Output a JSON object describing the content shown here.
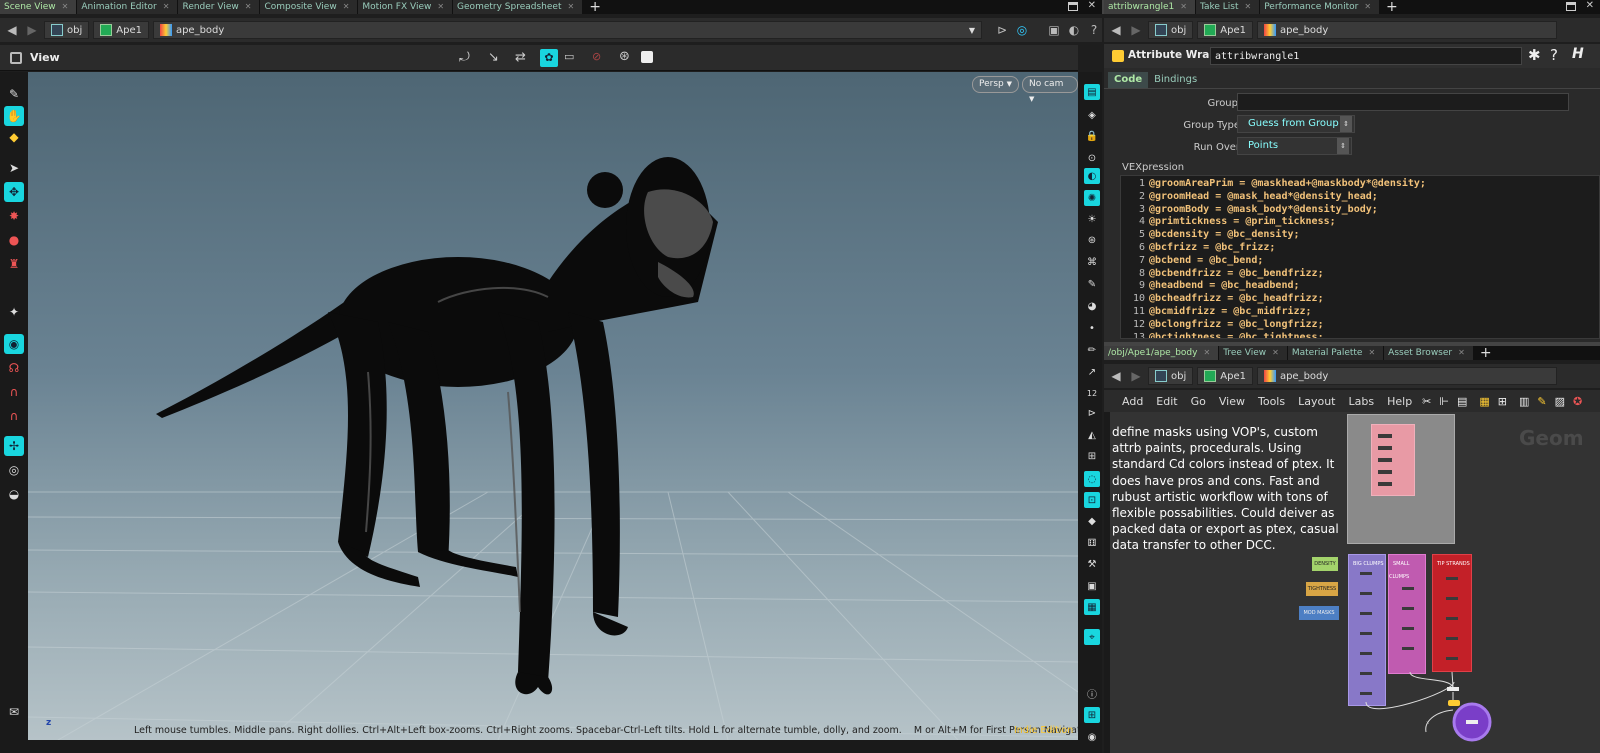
{
  "left_tabs": [
    {
      "label": "Scene View",
      "active": true
    },
    {
      "label": "Animation Editor"
    },
    {
      "label": "Render View"
    },
    {
      "label": "Composite View"
    },
    {
      "label": "Motion FX View"
    },
    {
      "label": "Geometry Spreadsheet"
    }
  ],
  "right_top_tabs": [
    {
      "label": "attribwrangle1",
      "active": true
    },
    {
      "label": "Take List"
    },
    {
      "label": "Performance Monitor"
    }
  ],
  "right_bottom_tabs": [
    {
      "label": "/obj/Ape1/ape_body",
      "active": true
    },
    {
      "label": "Tree View"
    },
    {
      "label": "Material Palette"
    },
    {
      "label": "Asset Browser"
    }
  ],
  "path": {
    "root": "obj",
    "object": "Ape1",
    "node": "ape_body"
  },
  "viewport": {
    "title": "View",
    "persp": "Persp",
    "cam": "No cam",
    "status": "Left mouse tumbles. Middle pans. Right dollies. Ctrl+Alt+Left box-zooms. Ctrl+Right zooms. Spacebar-Ctrl-Left tilts. Hold L for alternate tumble, dolly, and zoom.    M or Alt+M for First Person Navigation.",
    "edition": "Indie Edition",
    "axis": "z"
  },
  "params": {
    "type": "Attribute Wrangle",
    "name": "attribwrangle1",
    "tabs": [
      "Code",
      "Bindings"
    ],
    "group_label": "Group",
    "group_value": "",
    "group_type_label": "Group Type",
    "group_type_value": "Guess from Group",
    "run_over_label": "Run Over",
    "run_over_value": "Points",
    "vex_label": "VEXpression",
    "code": [
      "@groomAreaPrim = @maskhead+@maskbody*@density;",
      "@groomHead = @mask_head*@density_head;",
      "@groomBody = @mask_body*@density_body;",
      "@primtickness = @prim_tickness;",
      "@bcdensity = @bc_density;",
      "@bcfrizz = @bc_frizz;",
      "@bcbend = @bc_bend;",
      "@bcbendfrizz = @bc_bendfrizz;",
      "@headbend = @bc_headbend;",
      "@bcheadfrizz = @bc_headfrizz;",
      "@bcmidfrizz = @bc_midfrizz;",
      "@bclongfrizz = @bc_longfrizz;",
      "@bctightness = @bc_tightness;"
    ]
  },
  "network": {
    "menu": [
      "Add",
      "Edit",
      "Go",
      "View",
      "Tools",
      "Layout",
      "Labs",
      "Help"
    ],
    "note": "define masks using VOP's, custom attrb paints, procedurals. Using standard Cd colors instead of ptex. It does have pros and cons. Fast and rubust artistic workflow with tons of flexible possabilities. Could deiver as packed data or export as ptex, casual data transfer to other DCC.",
    "watermark": "Geom",
    "sticky": [
      "DENSITY",
      "TIGHTNESS",
      "MOD MASKS"
    ],
    "boxes": [
      "BIG CLUMPS",
      "SMALL CLUMPS",
      "TIP STRANDS"
    ]
  },
  "colors": {
    "accent": "#19d6df",
    "tab_active": "#aee8a6",
    "code": "#f2c27a"
  }
}
